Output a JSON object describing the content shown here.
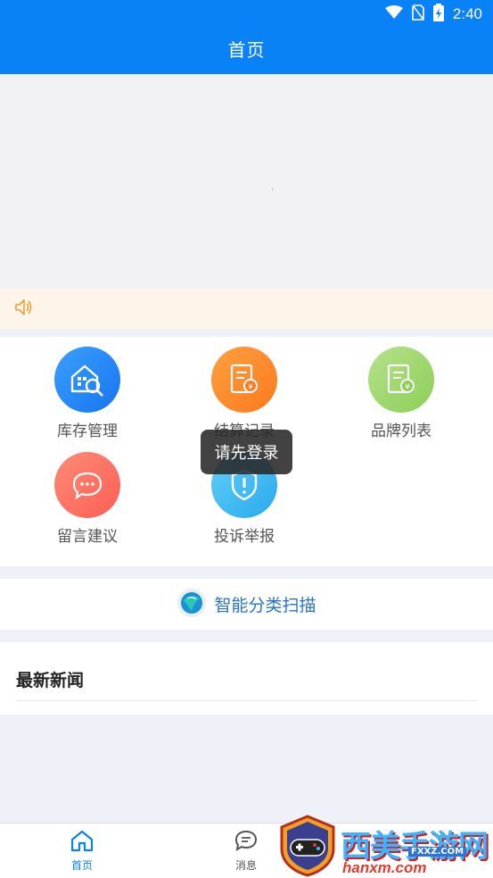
{
  "status_bar": {
    "time": "2:40"
  },
  "header": {
    "title": "首页"
  },
  "grid": {
    "items": [
      {
        "label": "库存管理",
        "icon": "warehouse-search-icon",
        "color": "#1774f0"
      },
      {
        "label": "结算记录",
        "icon": "document-yuan-icon",
        "color": "#fb7a1d"
      },
      {
        "label": "品牌列表",
        "icon": "list-yuan-icon",
        "color": "#8ccd58"
      },
      {
        "label": "留言建议",
        "icon": "chat-bubble-icon",
        "color": "#fb5f54"
      },
      {
        "label": "投诉举报",
        "icon": "shield-alert-icon",
        "color": "#28a8ee"
      }
    ]
  },
  "toast": {
    "text": "请先登录"
  },
  "scan": {
    "label": "智能分类扫描"
  },
  "news": {
    "title": "最新新闻"
  },
  "bottom_nav": {
    "items": [
      {
        "label": "首页",
        "icon": "home-icon",
        "active": true
      },
      {
        "label": "消息",
        "icon": "message-icon",
        "active": false
      }
    ],
    "active_color": "#0a82f7",
    "inactive_color": "#666666"
  },
  "watermark": {
    "brand": "西美手游网",
    "url": "hanxm.com",
    "url_small": "FXXZ.COM"
  }
}
